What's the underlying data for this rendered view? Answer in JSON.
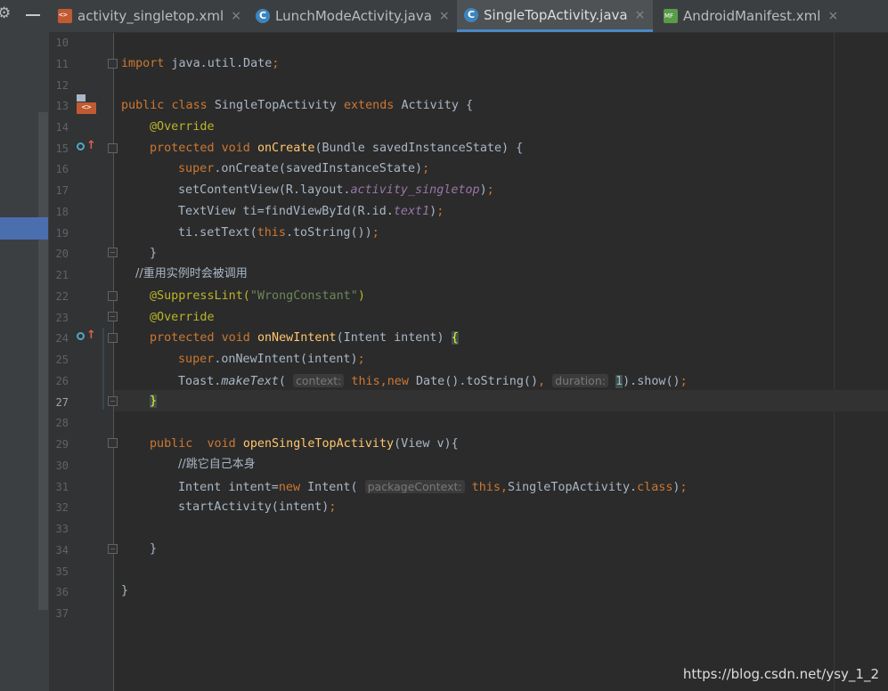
{
  "tabs": [
    {
      "label": "activity_singletop.xml",
      "icon": "xml-file-icon",
      "active": false,
      "closable": true
    },
    {
      "label": "LunchModeActivity.java",
      "icon": "java-class-icon",
      "active": false,
      "closable": true
    },
    {
      "label": "SingleTopActivity.java",
      "icon": "java-class-icon",
      "active": true,
      "closable": true
    },
    {
      "label": "AndroidManifest.xml",
      "icon": "manifest-file-icon",
      "active": false,
      "closable": true
    }
  ],
  "left_panel": {
    "gear_icon": "gear-icon",
    "minimize_icon": "minimize-icon"
  },
  "close_glyph": "×",
  "line_numbers": [
    "10",
    "11",
    "12",
    "13",
    "14",
    "15",
    "16",
    "17",
    "18",
    "19",
    "20",
    "21",
    "22",
    "23",
    "24",
    "25",
    "26",
    "27",
    "28",
    "29",
    "30",
    "31",
    "32",
    "33",
    "34",
    "35",
    "36",
    "37"
  ],
  "code": {
    "import": "import",
    "import_path": " java.util.Date",
    "semi": ";",
    "public": "public",
    "class": "class",
    "class_name": "SingleTopActivity",
    "extends": "extends",
    "super_class": "Activity",
    "open_brace": "{",
    "close_brace": "}",
    "override": "@Override",
    "protected": "protected",
    "void": "void",
    "oncreate": "onCreate",
    "oncreate_params": "(Bundle savedInstanceState) {",
    "super": "super",
    "super_oncreate_call": ".onCreate(savedInstanceState)",
    "setcontentview": "setContentView(R.layout.",
    "layout_name": "activity_singletop",
    "close_paren": ")",
    "textview_decl": "TextView ti=findViewById(R.id.",
    "id_name": "text1",
    "settext_start": "ti.setText(",
    "this": "this",
    "tostring_call": ".toString())",
    "comment_reuse": "//重用实例时会被调用",
    "suppress_lint": "@SuppressLint(",
    "wrong_constant": "\"WrongConstant\"",
    "onnewintent": "onNewIntent",
    "onnewintent_params": "(Intent intent) ",
    "super_onnewintent_call": ".onNewIntent(intent)",
    "toast": "Toast.",
    "maketext": "makeText",
    "open_paren": "(",
    "hint_context": "context:",
    "comma": ",",
    "new": "new",
    "date_tostring": " Date().toString()",
    "hint_duration": "duration:",
    "duration_value": "1",
    "show_call": ").show()",
    "open_method": "openSingleTopActivity",
    "open_params": "(View v){",
    "comment_self": "//跳它自己本身",
    "intent_decl": "Intent intent=",
    "intent_ctor": " Intent(",
    "hint_package": "packageContext:",
    "single_top_name": "SingleTopActivity.",
    "class_kw": "class",
    "start_activity": "startActivity(intent)"
  },
  "watermark": "https://blog.csdn.net/ysy_1_2"
}
